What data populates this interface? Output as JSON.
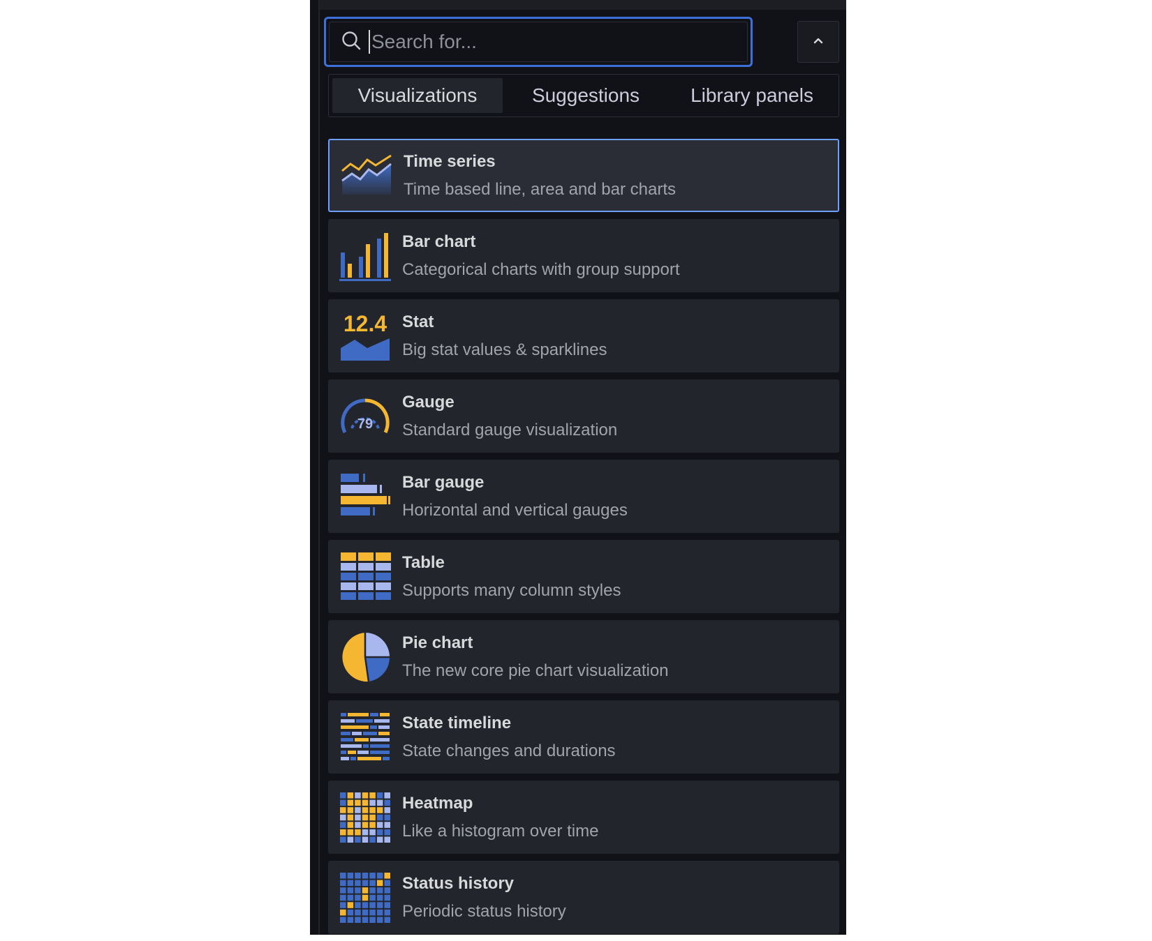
{
  "search": {
    "placeholder": "Search for...",
    "value": ""
  },
  "tabs": [
    {
      "label": "Visualizations",
      "active": true
    },
    {
      "label": "Suggestions",
      "active": false
    },
    {
      "label": "Library panels",
      "active": false
    }
  ],
  "visualizations": [
    {
      "name": "Time series",
      "description": "Time based line, area and bar charts",
      "icon": "time-series-icon",
      "selected": true
    },
    {
      "name": "Bar chart",
      "description": "Categorical charts with group support",
      "icon": "bar-chart-icon"
    },
    {
      "name": "Stat",
      "description": "Big stat values & sparklines",
      "icon": "stat-icon",
      "icon_text": "12.4"
    },
    {
      "name": "Gauge",
      "description": "Standard gauge visualization",
      "icon": "gauge-icon",
      "icon_text": "79"
    },
    {
      "name": "Bar gauge",
      "description": "Horizontal and vertical gauges",
      "icon": "bar-gauge-icon"
    },
    {
      "name": "Table",
      "description": "Supports many column styles",
      "icon": "table-icon"
    },
    {
      "name": "Pie chart",
      "description": "The new core pie chart visualization",
      "icon": "pie-chart-icon"
    },
    {
      "name": "State timeline",
      "description": "State changes and durations",
      "icon": "state-timeline-icon"
    },
    {
      "name": "Heatmap",
      "description": "Like a histogram over time",
      "icon": "heatmap-icon"
    },
    {
      "name": "Status history",
      "description": "Periodic status history",
      "icon": "status-history-icon"
    }
  ],
  "colors": {
    "accent_blue": "#3d71d9",
    "icon_blue": "#3f6bc4",
    "icon_light_blue": "#a8b8ee",
    "icon_yellow": "#f5b731",
    "panel_bg": "#111217",
    "card_bg": "#22252b"
  }
}
